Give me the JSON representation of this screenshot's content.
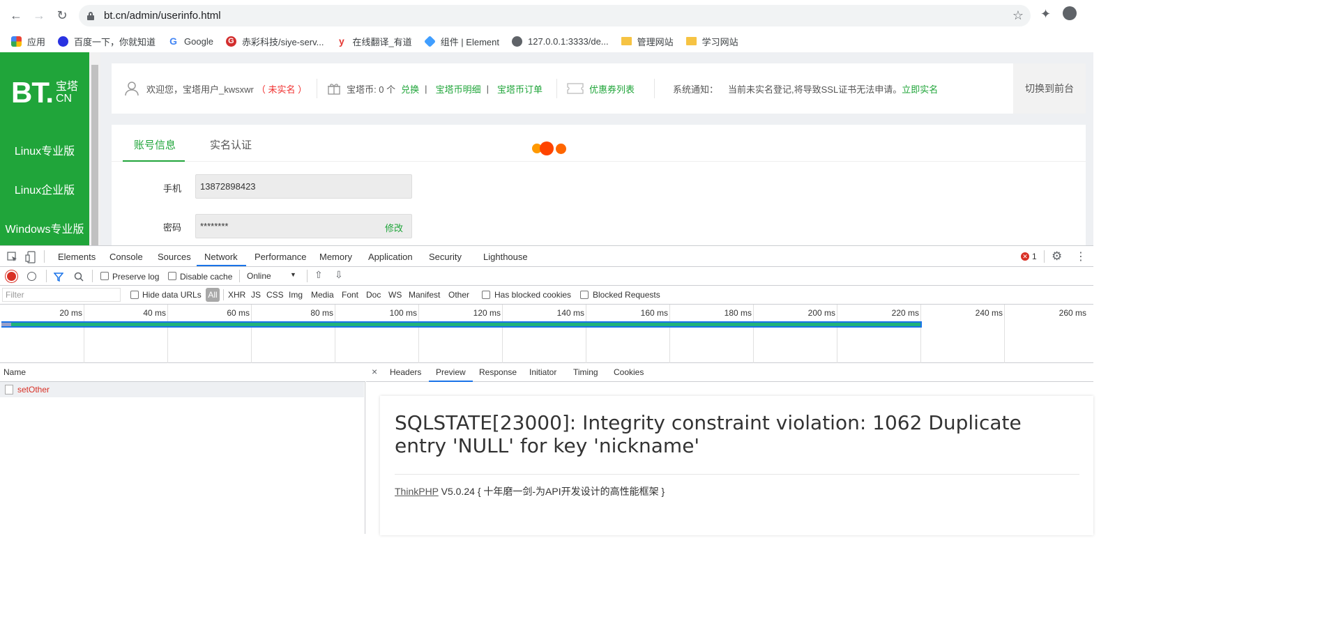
{
  "browser": {
    "url": "bt.cn/admin/userinfo.html",
    "bookmarks": [
      "应用",
      "百度一下，你就知道",
      "Google",
      "赤彩科技/siye-serv...",
      "在线翻译_有道",
      "组件 | Element",
      "127.0.0.1:3333/de...",
      "管理网站",
      "学习网站"
    ]
  },
  "sidebar": {
    "logo_bt": "BT.",
    "logo_cn_top": "宝塔",
    "logo_cn_bottom": "CN",
    "items": [
      "Linux专业版",
      "Linux企业版",
      "Windows专业版"
    ]
  },
  "topbar": {
    "welcome": "欢迎您，宝塔用户_kwsxwr",
    "unverified": "（ 未实名 ）",
    "coins_label": "宝塔币: 0 个",
    "exchange": "兑换",
    "sep": "|",
    "coin_detail": "宝塔币明细",
    "coin_orders": "宝塔币订单",
    "coupons": "优惠券列表",
    "notice_label": "系统通知：",
    "notice_text": "当前未实名登记,将导致SSL证书无法申请。",
    "notice_link": "立即实名",
    "switch_front": "切换到前台"
  },
  "account": {
    "tabs": [
      "账号信息",
      "实名认证"
    ],
    "phone_label": "手机",
    "phone_value": "13872898423",
    "password_label": "密码",
    "password_value": "********",
    "edit": "修改"
  },
  "devtools": {
    "tabs": [
      "Elements",
      "Console",
      "Sources",
      "Network",
      "Performance",
      "Memory",
      "Application",
      "Security",
      "Lighthouse"
    ],
    "error_count": "1",
    "preserve_log": "Preserve log",
    "disable_cache": "Disable cache",
    "throttle": "Online",
    "filter_placeholder": "Filter",
    "hide_data_urls": "Hide data URLs",
    "type_filters": [
      "All",
      "XHR",
      "JS",
      "CSS",
      "Img",
      "Media",
      "Font",
      "Doc",
      "WS",
      "Manifest",
      "Other"
    ],
    "has_blocked_cookies": "Has blocked cookies",
    "blocked_requests": "Blocked Requests",
    "ticks": [
      "20 ms",
      "40 ms",
      "60 ms",
      "80 ms",
      "100 ms",
      "120 ms",
      "140 ms",
      "160 ms",
      "180 ms",
      "200 ms",
      "220 ms",
      "240 ms",
      "260 ms"
    ],
    "name_header": "Name",
    "request_name": "setOther",
    "detail_tabs": [
      "Headers",
      "Preview",
      "Response",
      "Initiator",
      "Timing",
      "Cookies"
    ],
    "error_message": "SQLSTATE[23000]: Integrity constraint violation: 1062 Duplicate entry 'NULL' for key 'nickname'",
    "framework_link": "ThinkPHP",
    "framework_version": " V5.0.24",
    "framework_slogan": " { 十年磨一剑-为API开发设计的高性能框架 }"
  }
}
